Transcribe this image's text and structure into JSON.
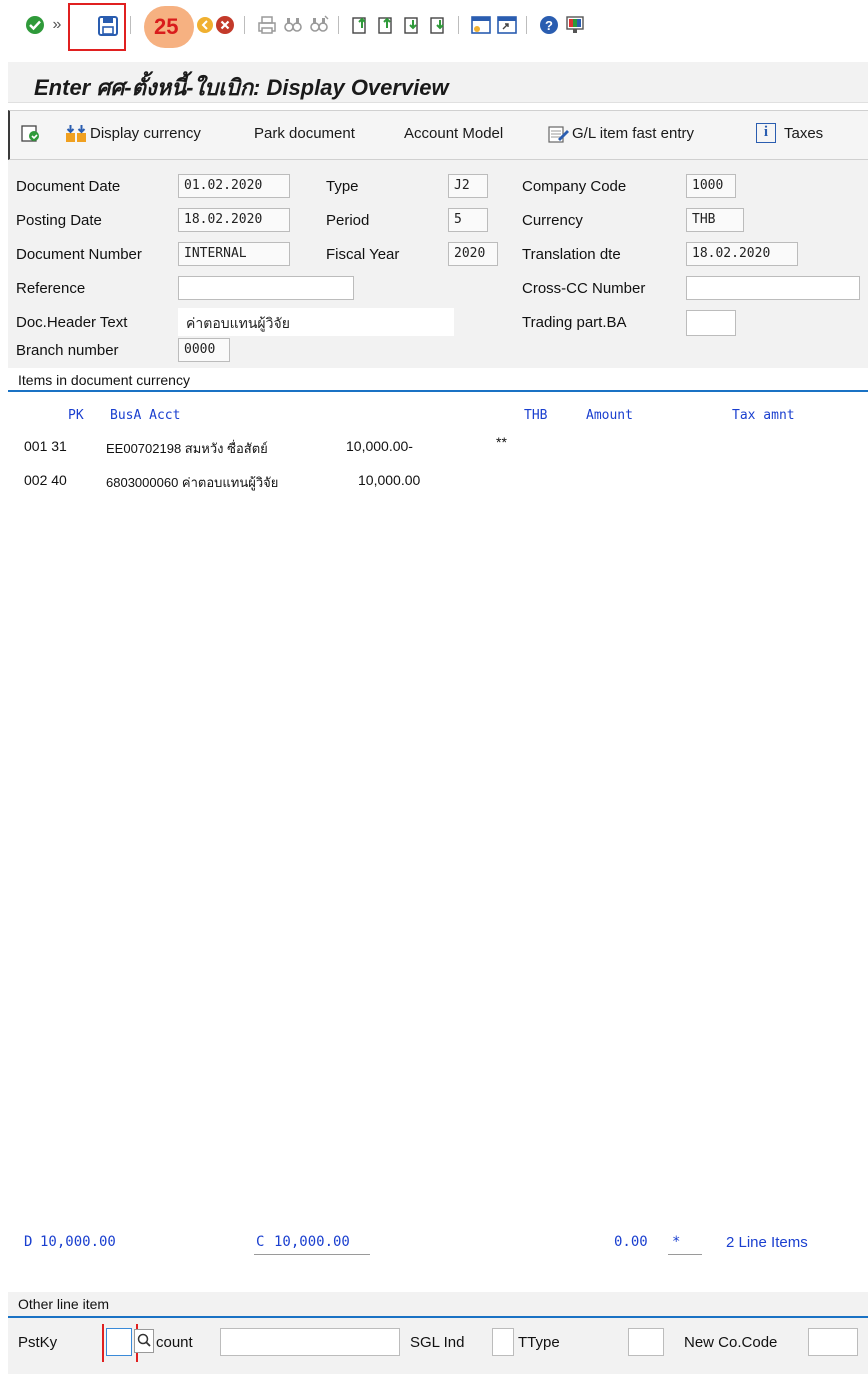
{
  "toolbar": {
    "step_badge": "25",
    "icons": [
      "check-icon",
      "expand-icon",
      "save-icon",
      "back-icon",
      "cancel-icon",
      "print-icon",
      "find-icon",
      "find-next-icon",
      "first-page-icon",
      "previous-page-icon",
      "next-page-icon",
      "last-page-icon",
      "create-session-icon",
      "shortcut-icon",
      "help-icon",
      "customize-layout-icon"
    ]
  },
  "title": "Enter ศศ-ตั้งหนี้-ใบเบิก: Display Overview",
  "app_toolbar": {
    "display_currency": "Display currency",
    "park_document": "Park document",
    "account_model": "Account Model",
    "gl_fast_entry": "G/L item fast entry",
    "taxes": "Taxes"
  },
  "header_fields": {
    "document_date_label": "Document Date",
    "document_date": "01.02.2020",
    "type_label": "Type",
    "type": "J2",
    "company_code_label": "Company Code",
    "company_code": "1000",
    "posting_date_label": "Posting Date",
    "posting_date": "18.02.2020",
    "period_label": "Period",
    "period": "5",
    "currency_label": "Currency",
    "currency": "THB",
    "document_number_label": "Document Number",
    "document_number": "INTERNAL",
    "fiscal_year_label": "Fiscal Year",
    "fiscal_year": "2020",
    "translation_date_label": "Translation dte",
    "translation_date": "18.02.2020",
    "reference_label": "Reference",
    "reference": "",
    "cross_cc_label": "Cross-CC Number",
    "cross_cc": "",
    "doc_header_text_label": "Doc.Header Text",
    "doc_header_text": "ค่าตอบแทนผู้วิจัย",
    "trading_part_label": "Trading part.BA",
    "trading_part": "",
    "branch_number_label": "Branch number",
    "branch_number": "0000"
  },
  "items": {
    "section_title": "Items in document currency",
    "col_pk": "PK",
    "col_busa_acct": "BusA Acct",
    "col_currency": "THB",
    "col_amount": "Amount",
    "col_tax": "Tax amnt",
    "rows": [
      {
        "line": "001 31",
        "acct": "EE00702198 สมหวัง ซื่อสัตย์",
        "amount": "10,000.00-",
        "flag": "**"
      },
      {
        "line": "002 40",
        "acct": "6803000060 ค่าตอบแทนผู้วิจัย",
        "amount": "10,000.00",
        "flag": ""
      }
    ]
  },
  "totals": {
    "debit_prefix": "D",
    "debit": "10,000.00",
    "credit_prefix": "C",
    "credit": "10,000.00",
    "balance": "0.00",
    "balance_flag": "*",
    "line_items": "2 Line Items"
  },
  "other_line_item": {
    "section_title": "Other line item",
    "pstky_label": "PstKy",
    "pstky_value": "",
    "account_label": "count",
    "account_value": "",
    "sgl_ind_label": "SGL Ind",
    "sgl_ind_value": "",
    "ttype_label": "TType",
    "ttype_value": "",
    "new_cocode_label": "New Co.Code",
    "new_cocode_value": ""
  },
  "colors": {
    "highlight": "#f5a36b",
    "badge_text": "#d91c1c",
    "blue_text": "#1a3fcf",
    "section_line": "#1a72c4"
  }
}
